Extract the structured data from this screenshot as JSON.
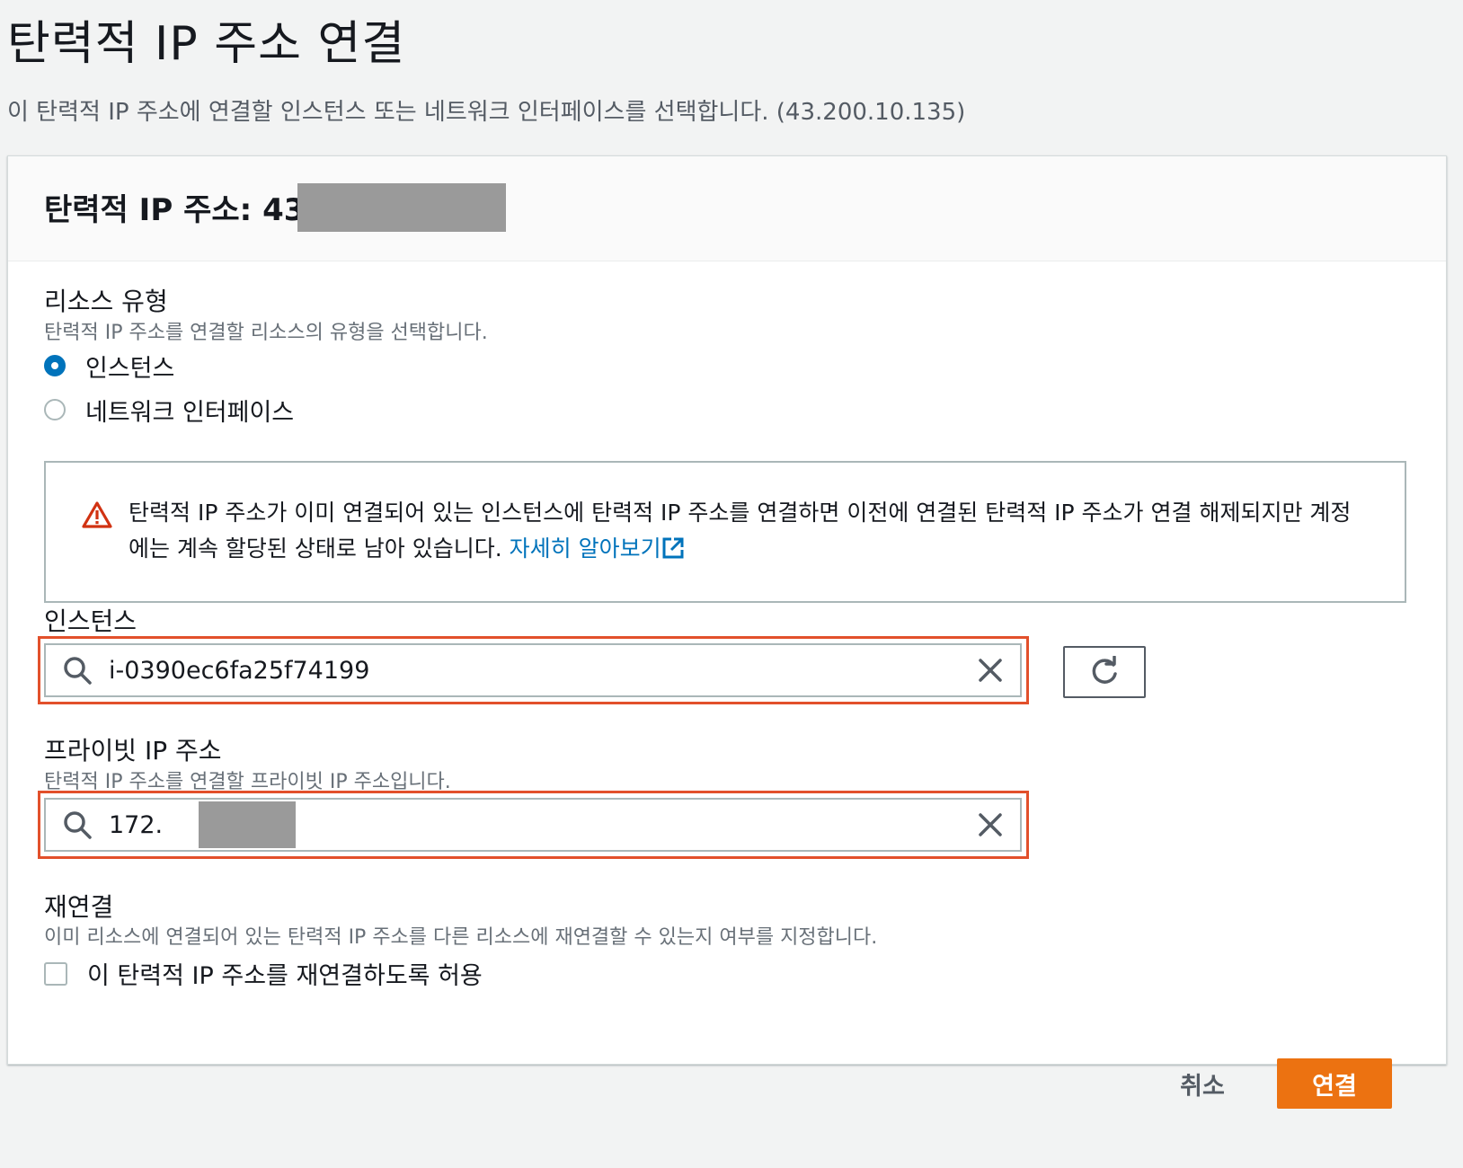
{
  "page": {
    "title": "탄력적 IP 주소 연결",
    "description": "이 탄력적 IP 주소에 연결할 인스턴스 또는 네트워크 인터페이스를 선택합니다. (43.200.10.135)"
  },
  "card": {
    "title": "탄력적 IP 주소: 43."
  },
  "resource_type": {
    "label": "리소스 유형",
    "description": "탄력적 IP 주소를 연결할 리소스의 유형을 선택합니다.",
    "options": [
      {
        "label": "인스턴스",
        "selected": true
      },
      {
        "label": "네트워크 인터페이스",
        "selected": false
      }
    ]
  },
  "alert": {
    "text": "탄력적 IP 주소가 이미 연결되어 있는 인스턴스에 탄력적 IP 주소를 연결하면 이전에 연결된 탄력적 IP 주소가 연결 해제되지만 계정에는 계속 할당된 상태로 남아 있습니다. ",
    "link": "자세히 알아보기"
  },
  "instance": {
    "label": "인스턴스",
    "value": "i-0390ec6fa25f74199"
  },
  "private_ip": {
    "label": "프라이빗 IP 주소",
    "description": "탄력적 IP 주소를 연결할 프라이빗 IP 주소입니다.",
    "value": "172."
  },
  "reassociation": {
    "label": "재연결",
    "description": "이미 리소스에 연결되어 있는 탄력적 IP 주소를 다른 리소스에 재연결할 수 있는지 여부를 지정합니다.",
    "checkbox_label": "이 탄력적 IP 주소를 재연결하도록 허용",
    "checked": false
  },
  "actions": {
    "cancel": "취소",
    "associate": "연결"
  },
  "colors": {
    "accent": "#0073bb",
    "primary_button": "#ec7211",
    "highlight": "#e2502b",
    "warning": "#d13212"
  },
  "icons": [
    "warning-icon",
    "external-link-icon",
    "search-icon",
    "clear-icon",
    "refresh-icon"
  ]
}
